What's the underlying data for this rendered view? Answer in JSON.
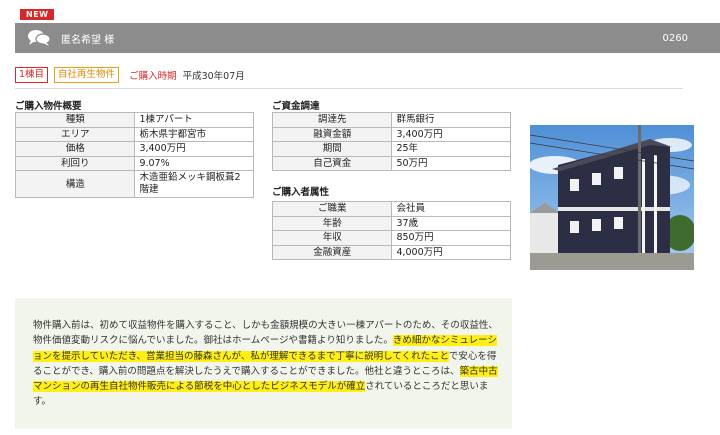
{
  "badge": {
    "new": "NEW"
  },
  "header": {
    "icon": "chat-bubbles-icon",
    "customer_name": "匿名希望 様",
    "record_id": "0260"
  },
  "tags": {
    "first": "1棟目",
    "type": "自社再生物件",
    "period_label": "ご購入時期",
    "period_value": "平成30年07月"
  },
  "property": {
    "title": "ご購入物件概要",
    "rows": [
      {
        "key": "種類",
        "value": "1棟アパート"
      },
      {
        "key": "エリア",
        "value": "栃木県宇都宮市"
      },
      {
        "key": "価格",
        "value": "3,400万円"
      },
      {
        "key": "利回り",
        "value": "9.07%"
      },
      {
        "key": "構造",
        "value": "木造亜鉛メッキ鋼板葺2階建"
      }
    ]
  },
  "funding": {
    "title": "ご資金調達",
    "rows": [
      {
        "key": "調達先",
        "value": "群馬銀行"
      },
      {
        "key": "融資金額",
        "value": "3,400万円"
      },
      {
        "key": "期間",
        "value": "25年"
      },
      {
        "key": "自己資金",
        "value": "50万円"
      }
    ]
  },
  "buyer": {
    "title": "ご購入者属性",
    "rows": [
      {
        "key": "ご職業",
        "value": "会社員"
      },
      {
        "key": "年齢",
        "value": "37歳"
      },
      {
        "key": "年収",
        "value": "850万円"
      },
      {
        "key": "金融資産",
        "value": "4,000万円"
      }
    ]
  },
  "comment": {
    "part1": "物件購入前は、初めて収益物件を購入すること、しかも金額規模の大きい一棟アパートのため、その収益性、物件価値変動リスクに悩んでいました。御社はホームページや書籍より知りました。",
    "hl1": "きめ細かなシミュレーションを提示していただき、営業担当の藤森さんが、私が理解できるまで丁寧に説明してくれたこと",
    "part2": "で安心を得ることができ、購入前の問題点を解決したうえで購入することができました。他社と違うところは、",
    "hl2": "築古中古マンションの再生自社物件販売による節税を中心としたビジネスモデルが確立",
    "part3": "されているところだと思います。"
  },
  "colors": {
    "header_bg": "#8c8c8c",
    "accent_red": "#d62828",
    "accent_orange": "#e08a00",
    "highlight": "#ffef14",
    "comment_bg": "#f1f5ec"
  }
}
